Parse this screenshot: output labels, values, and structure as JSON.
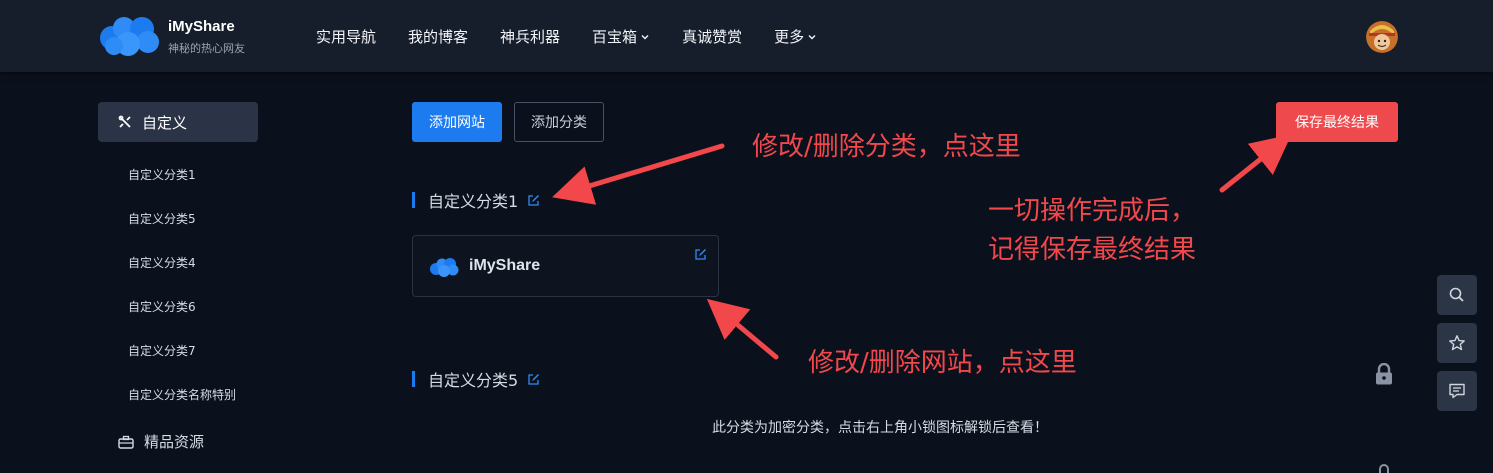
{
  "brand": {
    "name": "iMyShare",
    "subtitle": "神秘的热心网友"
  },
  "nav": [
    {
      "label": "实用导航",
      "dropdown": false
    },
    {
      "label": "我的博客",
      "dropdown": false
    },
    {
      "label": "神兵利器",
      "dropdown": false
    },
    {
      "label": "百宝箱",
      "dropdown": true
    },
    {
      "label": "真诚赞赏",
      "dropdown": false
    },
    {
      "label": "更多",
      "dropdown": true
    }
  ],
  "sidebar": {
    "active_label": "自定义",
    "active_icon": "tools-icon",
    "items": [
      "自定义分类1",
      "自定义分类5",
      "自定义分类4",
      "自定义分类6",
      "自定义分类7",
      "自定义分类名称特别"
    ],
    "resources_label": "精品资源",
    "resources_icon": "briefcase-icon"
  },
  "toolbar": {
    "add_site_label": "添加网站",
    "add_category_label": "添加分类",
    "save_label": "保存最终结果"
  },
  "categories": [
    {
      "title": "自定义分类1",
      "sites": [
        {
          "name": "iMyShare"
        }
      ]
    },
    {
      "title": "自定义分类5",
      "locked": true,
      "locked_message": "此分类为加密分类，点击右上角小锁图标解锁后查看！"
    }
  ],
  "annotations": {
    "edit_category": "修改/删除分类，点这里",
    "save_line1": "一切操作完成后，",
    "save_line2": "记得保存最终结果",
    "edit_site": "修改/删除网站，点这里"
  },
  "floating": [
    "search-icon",
    "star-icon",
    "comment-icon"
  ],
  "colors": {
    "accent": "#1d7bf0",
    "danger": "#ee4a4d",
    "annotation": "#f2474b",
    "background": "#0b111c",
    "header": "#161e2c"
  }
}
